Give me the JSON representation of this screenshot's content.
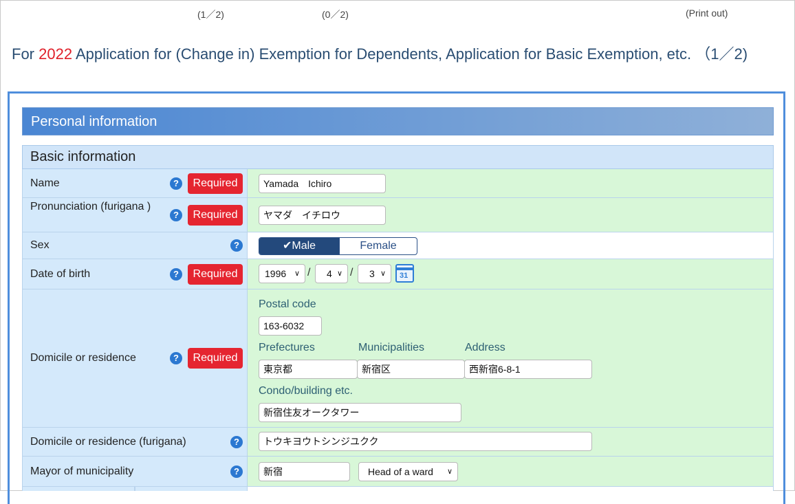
{
  "top": {
    "progress_a": "(1／2)",
    "progress_b": "(0／2)",
    "print": "(Print out)"
  },
  "heading": {
    "prefix": "For ",
    "year": "2022",
    "rest": " Application for (Change in) Exemption for Dependents, Application for Basic Exemption, etc. （1／2)"
  },
  "section": {
    "title": "Personal information"
  },
  "basic": {
    "title": "Basic information"
  },
  "required_label": "Required",
  "help_glyph": "?",
  "fields": {
    "name": {
      "label": "Name",
      "value": "Yamada　Ichiro"
    },
    "furigana": {
      "label": "Pronunciation (furigana )",
      "value": "ヤマダ　イチロウ"
    },
    "sex": {
      "label": "Sex",
      "male": "✔Male",
      "female": "Female",
      "selected": "Male"
    },
    "dob": {
      "label": "Date of birth",
      "year": "1996",
      "month": "4",
      "day": "3",
      "sep": "/"
    },
    "domicile": {
      "label": "Domicile or residence",
      "postal_label": "Postal code",
      "postal": "163-6032",
      "pref_label": "Prefectures",
      "pref": "東京都",
      "muni_label": "Municipalities",
      "muni": "新宿区",
      "addr_label": "Address",
      "addr": "西新宿6-8-1",
      "condo_label": "Condo/building etc.",
      "condo": "新宿住友オークタワー"
    },
    "domicile_furigana": {
      "label": "Domicile or residence (furigana)",
      "value": "トウキヨウトシンジユクク"
    },
    "mayor": {
      "label": "Mayor of municipality",
      "value": "新宿",
      "title": "Head of a ward"
    }
  },
  "icons": {
    "calendar": "calendar-icon",
    "help": "help-icon",
    "dropdown": "chevron-down-icon"
  },
  "colors": {
    "accent": "#4f8edc",
    "required": "#e52530",
    "year": "#e0202a",
    "label_bg": "#d4e9fb",
    "input_bg": "#d8f7d8"
  }
}
